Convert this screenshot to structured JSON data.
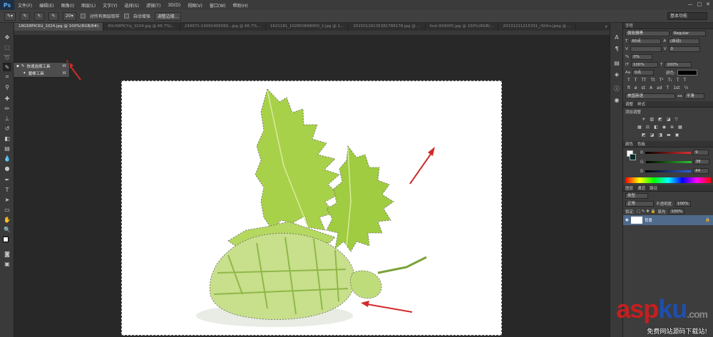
{
  "app": {
    "logo": "Ps"
  },
  "menubar": {
    "items": [
      "文件(F)",
      "编辑(E)",
      "图像(I)",
      "图层(L)",
      "文字(Y)",
      "选择(S)",
      "滤镜(T)",
      "3D(D)",
      "视图(V)",
      "窗口(W)",
      "帮助(H)"
    ],
    "window_controls": [
      "—",
      "□",
      "✕"
    ]
  },
  "options": {
    "brush_size": "20",
    "sample_all_layers": "对所有图层取样",
    "auto_enhance": "自动增强",
    "refine_edge": "调整边缘...",
    "workspace": "基本功能"
  },
  "tabs": [
    {
      "label": "18G58PIC6U_1024.jpg @ 100%(RGB/8#)",
      "active": true
    },
    {
      "label": "60c58PICYzj_1024.jpg @ 66.7%(...",
      "active": false
    },
    {
      "label": "234971-14091405060...jpg @ 66.7%...",
      "active": false
    },
    {
      "label": "1621181_102650668000_2.jpg @ 1...",
      "active": false
    },
    {
      "label": "20150116135381788178.jpg @ ...",
      "active": false
    },
    {
      "label": "fxxt-934005.jpg @ 100%(RGB/...",
      "active": false
    },
    {
      "label": "20131211215331_rSUhv.jpeg @ ...",
      "active": false
    }
  ],
  "tab_overflow": "»",
  "flyout": {
    "items": [
      {
        "label": "快速选择工具",
        "key": "W"
      },
      {
        "label": "魔棒工具",
        "key": "W"
      }
    ]
  },
  "character_panel": {
    "tab": "字符",
    "font": "微软雅黑",
    "style": "Regular",
    "size": "60点",
    "leading": "(自动)",
    "tracking": "0",
    "kerning": "0%",
    "vscale": "100%",
    "hscale": "100%",
    "baseline": "0点",
    "color_label": "颜色:",
    "language": "美国英语",
    "aa_label": "aa",
    "aa": "平滑"
  },
  "adjust_panel": {
    "tabs": [
      "调整",
      "样式"
    ],
    "title": "添加调整"
  },
  "color_panel": {
    "tabs": [
      "颜色",
      "色板"
    ],
    "channels": [
      {
        "name": "R",
        "value": "9",
        "color": "#e03030"
      },
      {
        "name": "G",
        "value": "38",
        "color": "#30c030"
      },
      {
        "name": "B",
        "value": "44",
        "color": "#3060e0"
      }
    ]
  },
  "layers_panel": {
    "tabs": [
      "图层",
      "通道",
      "路径"
    ],
    "kind": "类型",
    "blend": "正常",
    "opacity_label": "不透明度:",
    "opacity": "100%",
    "lock_label": "锁定:",
    "fill_label": "填充:",
    "fill": "100%",
    "layer_name": "背景"
  },
  "watermark": {
    "main_1": "asp",
    "main_2": "ku",
    "suffix": ".com",
    "sub": "免费网站源码下载站!"
  }
}
